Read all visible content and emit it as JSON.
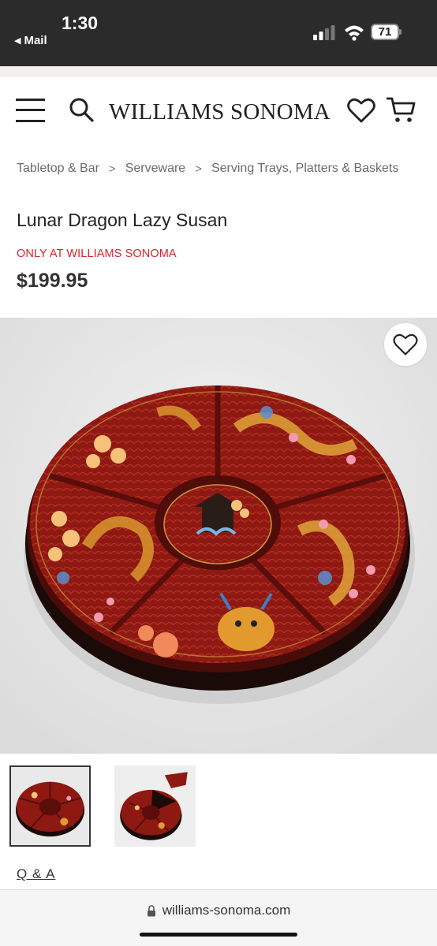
{
  "status_bar": {
    "time": "1:30",
    "back_app": "Mail",
    "battery": "71",
    "icons": [
      "signal-icon",
      "wifi-icon",
      "battery-icon"
    ]
  },
  "header": {
    "brand": "WILLIAMS SONOMA",
    "icons": [
      "menu-icon",
      "search-icon",
      "heart-icon",
      "cart-icon"
    ]
  },
  "breadcrumb": [
    "Tabletop & Bar",
    "Serveware",
    "Serving Trays, Platters & Baskets"
  ],
  "breadcrumb_separator": ">",
  "product": {
    "title": "Lunar Dragon Lazy Susan",
    "badge": "ONLY AT WILLIAMS SONOMA",
    "price": "$199.95"
  },
  "gallery": {
    "thumbnail_count": 2,
    "selected_index": 0
  },
  "links": {
    "qa": "Q & A"
  },
  "browser": {
    "url": "williams-sonoma.com"
  },
  "colors": {
    "status_bar_bg": "#2b2b2b",
    "exclusive_red": "#d6242a",
    "lacquer_red": "#8a1a14",
    "gold": "#e0a53a"
  }
}
